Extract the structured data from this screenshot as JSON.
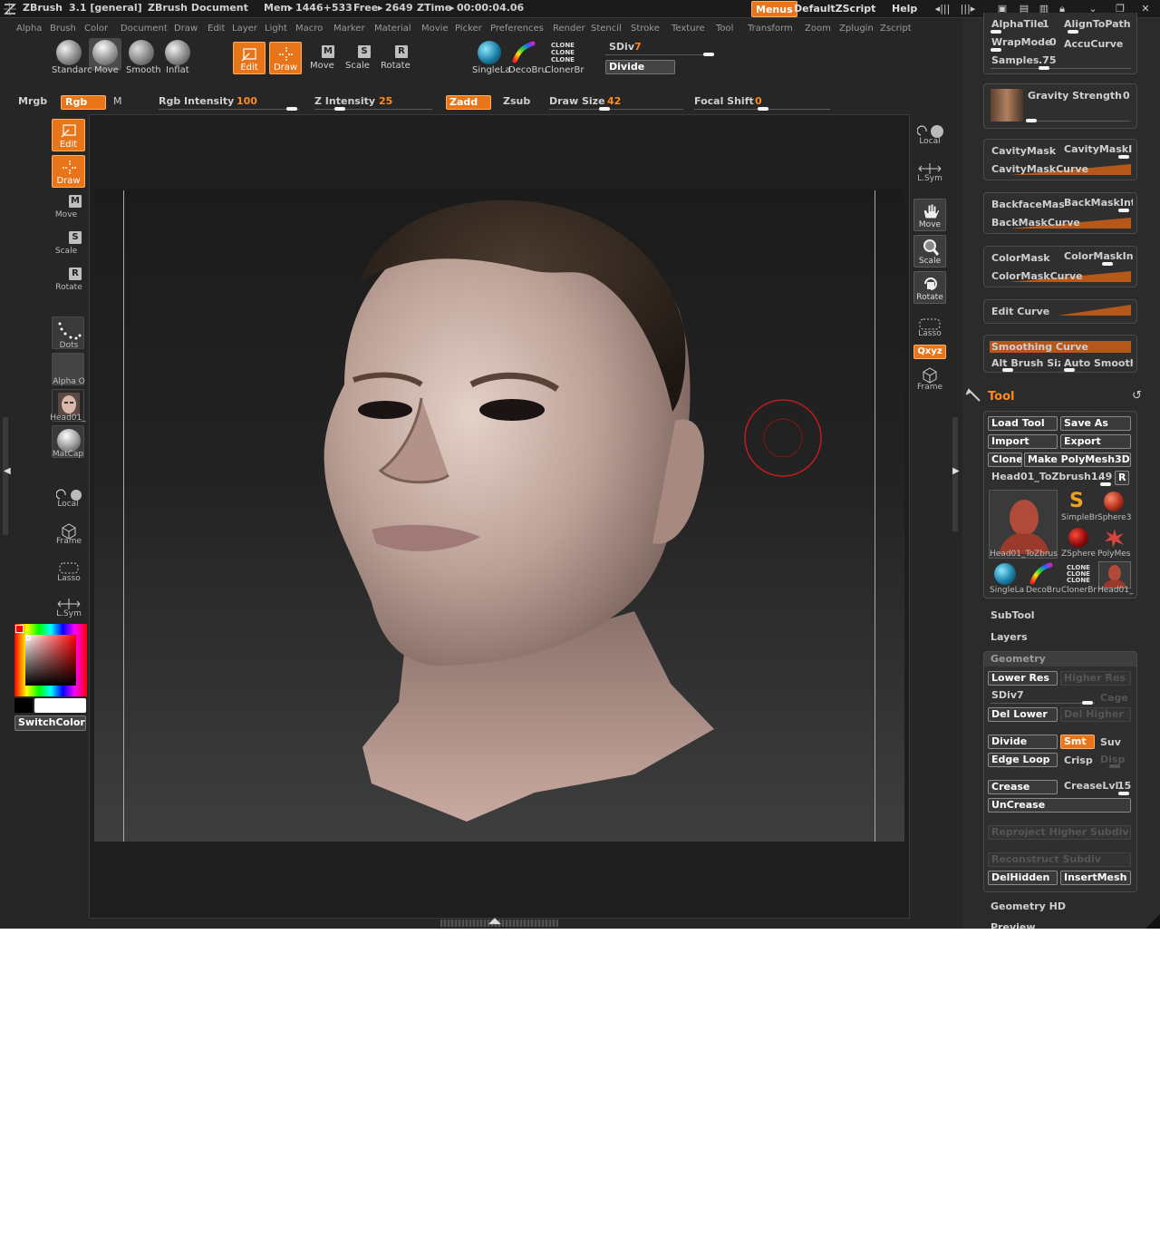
{
  "titlebar": {
    "app": "ZBrush",
    "version": "3.1 [general]",
    "document": "ZBrush Document",
    "mem_label": "Mem",
    "mem_value": "1446+533",
    "free_label": "Free",
    "free_value": "2649",
    "ztime_label": "ZTime",
    "ztime_value": "00:00:04.06",
    "menus_btn": "Menus",
    "script": "DefaultZScript",
    "help": "Help"
  },
  "menubar": [
    "Alpha",
    "Brush",
    "Color",
    "Document",
    "Draw",
    "Edit",
    "Layer",
    "Light",
    "Macro",
    "Marker",
    "Material",
    "Movie",
    "Picker",
    "Preferences",
    "Render",
    "Stencil",
    "Stroke",
    "Texture",
    "Tool",
    "Transform",
    "Zoom",
    "Zplugin",
    "Zscript"
  ],
  "brushes": [
    "Standarc",
    "Move",
    "Smooth",
    "Inflat"
  ],
  "modes": {
    "edit": "Edit",
    "draw": "Draw",
    "move": "Move",
    "scale": "Scale",
    "rotate": "Rotate"
  },
  "tools_top": [
    "SingleLa",
    "DecoBru",
    "ClonerBr"
  ],
  "clone_text": "CLONE",
  "sdiv": {
    "label": "SDiv",
    "value": "7",
    "level": 0.9
  },
  "divide_btn": "Divide",
  "row2": {
    "mrgb": "Mrgb",
    "rgb": "Rgb",
    "m": "M",
    "rgb_intensity_label": "Rgb Intensity",
    "rgb_intensity": "100",
    "z_intensity_label": "Z Intensity",
    "z_intensity": "25",
    "zadd": "Zadd",
    "zsub": "Zsub",
    "draw_size_label": "Draw Size",
    "draw_size": "42",
    "focal_shift_label": "Focal Shift",
    "focal_shift": "0"
  },
  "leftshelf": {
    "edit": "Edit",
    "draw": "Draw",
    "move": "Move",
    "scale": "Scale",
    "rotate": "Rotate",
    "dots": "Dots",
    "alpha": "Alpha O",
    "head": "Head01_",
    "matcap": "MatCap",
    "local": "Local",
    "frame": "Frame",
    "lasso": "Lasso",
    "lsym": "L.Sym",
    "switchcolor": "SwitchColor"
  },
  "rightshelf": {
    "local": "Local",
    "lsym": "L.Sym",
    "move": "Move",
    "scale": "Scale",
    "rotate": "Rotate",
    "lasso": "Lasso",
    "xyz": "Qxyz",
    "frame": "Frame"
  },
  "tray": {
    "alphatile_label": "AlphaTile",
    "alphatile": "1",
    "aligntopath": "AlignToPath",
    "wrapmode_label": "WrapMode",
    "wrapmode": "0",
    "accucurve": "AccuCurve",
    "samples_label": "Samples",
    "samples": ".75",
    "gravity_label": "Gravity Strength",
    "gravity": "0",
    "cavitymask": "CavityMask",
    "cavitymaskint": "CavityMaskIn",
    "cavitymaskcurve": "CavityMaskCurve",
    "backfacemask": "BackfaceMas",
    "backmaskint": "BackMaskInt",
    "backmaskcurve": "BackMaskCurve",
    "colormask": "ColorMask",
    "colormaskint": "ColorMaskInt",
    "colormaskcurve": "ColorMaskCurve",
    "editcurve": "Edit Curve",
    "smoothingcurve": "Smoothing Curve",
    "altbrush": "Alt Brush Siz",
    "autosmooth": "Auto Smooth"
  },
  "tool": {
    "title": "Tool",
    "load": "Load Tool",
    "save": "Save As",
    "import": "Import",
    "export": "Export",
    "clone": "Clone",
    "polymesh": "Make PolyMesh3D",
    "current": "Head01_ToZbrush1.",
    "current_value": "49",
    "r": "R",
    "thumbs": [
      "Head01_ToZbrus",
      "SimpleBr",
      "Sphere3",
      "ZSphere",
      "PolyMes",
      "SingleLa",
      "DecoBru",
      "ClonerBr",
      "Head01_"
    ],
    "subtool": "SubTool",
    "layers": "Layers",
    "geometry": "Geometry",
    "lowerres": "Lower Res",
    "higherres": "Higher Res",
    "sdiv_label": "SDiv",
    "sdiv": "7",
    "cage": "Cage",
    "dellower": "Del Lower",
    "delhigher": "Del Higher",
    "divide": "Divide",
    "smt": "Smt",
    "suv": "Suv",
    "edgeloop": "Edge Loop",
    "crisp": "Crisp",
    "disp": "Disp",
    "crease": "Crease",
    "creaselvl_label": "CreaseLvl",
    "creaselvl": "15",
    "uncrease": "UnCrease",
    "reproject": "Reproject Higher Subdiv",
    "reconstruct": "Reconstruct Subdiv",
    "delhidden": "DelHidden",
    "insertmesh": "InsertMesh",
    "geometryhd": "Geometry HD",
    "preview": "Preview"
  },
  "colors": {
    "accent": "#e8751a",
    "bg": "#262626",
    "panel": "#2f2f2f"
  }
}
